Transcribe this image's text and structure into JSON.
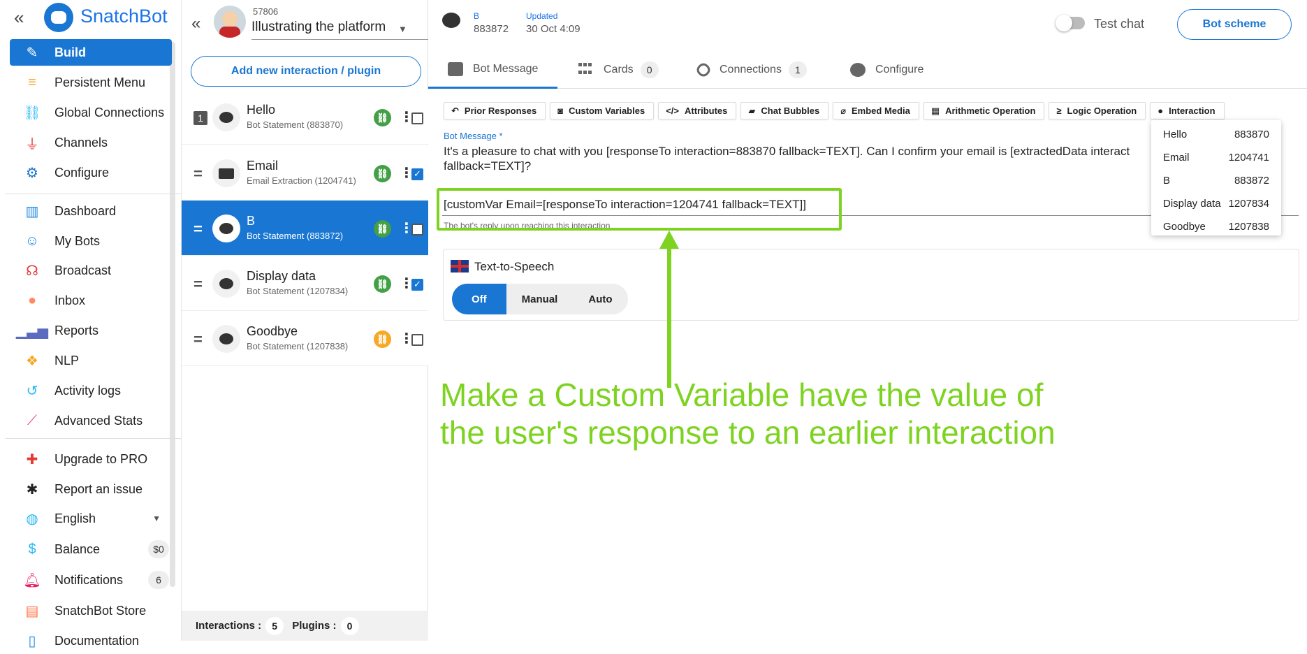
{
  "sidebar": {
    "brand": "SnatchBot",
    "items": [
      {
        "label": "Build",
        "icon": "edit-icon"
      },
      {
        "label": "Persistent Menu",
        "icon": "menu-icon"
      },
      {
        "label": "Global Connections",
        "icon": "link-icon"
      },
      {
        "label": "Channels",
        "icon": "plug-icon"
      },
      {
        "label": "Configure",
        "icon": "gear-icon"
      },
      {
        "label": "Dashboard",
        "icon": "dashboard-icon"
      },
      {
        "label": "My Bots",
        "icon": "robot-icon"
      },
      {
        "label": "Broadcast",
        "icon": "broadcast-icon"
      },
      {
        "label": "Inbox",
        "icon": "chat-icon"
      },
      {
        "label": "Reports",
        "icon": "bar-chart-icon"
      },
      {
        "label": "NLP",
        "icon": "nlp-icon"
      },
      {
        "label": "Activity logs",
        "icon": "history-icon"
      },
      {
        "label": "Advanced Stats",
        "icon": "line-chart-icon"
      },
      {
        "label": "Upgrade to PRO",
        "icon": "plus-icon"
      },
      {
        "label": "Report an issue",
        "icon": "bug-icon"
      },
      {
        "label": "English",
        "icon": "globe-icon"
      },
      {
        "label": "Balance",
        "icon": "dollar-icon",
        "badge": "$0"
      },
      {
        "label": "Notifications",
        "icon": "bell-icon",
        "badge": "6"
      },
      {
        "label": "SnatchBot Store",
        "icon": "store-icon"
      },
      {
        "label": "Documentation",
        "icon": "doc-icon"
      }
    ]
  },
  "panel": {
    "bot_id": "57806",
    "bot_name": "Illustrating the platform",
    "add_button": "Add new interaction / plugin",
    "interactions": [
      {
        "index": "1",
        "name": "Hello",
        "sub": "Bot Statement (883870)",
        "checked": false
      },
      {
        "name": "Email",
        "sub": "Email Extraction (1204741)",
        "checked": true
      },
      {
        "name": "B",
        "sub": "Bot Statement (883872)",
        "checked": false
      },
      {
        "name": "Display data",
        "sub": "Bot Statement (1207834)",
        "checked": true
      },
      {
        "name": "Goodbye",
        "sub": "Bot Statement (1207838)",
        "checked": false
      }
    ],
    "footer": {
      "interactions_label": "Interactions :",
      "interactions_count": "5",
      "plugins_label": "Plugins :",
      "plugins_count": "0"
    }
  },
  "main": {
    "top": {
      "name": "B",
      "id": "883872",
      "updated_label": "Updated",
      "updated_date": "30 Oct 4:09",
      "test_chat": "Test chat",
      "scheme": "Bot scheme"
    },
    "tabs": [
      {
        "label": "Bot Message"
      },
      {
        "label": "Cards",
        "count": "0"
      },
      {
        "label": "Connections",
        "count": "1"
      },
      {
        "label": "Configure"
      }
    ],
    "tools": [
      {
        "label": "Prior Responses",
        "icon": "↶"
      },
      {
        "label": "Custom Variables",
        "icon": "◙"
      },
      {
        "label": "Attributes",
        "icon": "</>"
      },
      {
        "label": "Chat Bubbles",
        "icon": "▰"
      },
      {
        "label": "Embed Media",
        "icon": "⌀"
      },
      {
        "label": "Arithmetic Operation",
        "icon": "▦"
      },
      {
        "label": "Logic Operation",
        "icon": "≥"
      },
      {
        "label": "Interaction",
        "icon": "●"
      }
    ],
    "bot_message_label": "Bot Message *",
    "bot_message_text": "It's a pleasure to chat with you [responseTo interaction=883870 fallback=TEXT]. Can I confirm your email is [extractedData interact",
    "bot_message_text_2": "fallback=TEXT]?",
    "bot_message_line": "[customVar Email=[responseTo interaction=1204741 fallback=TEXT]]",
    "hint": "The bot's reply upon reaching this interaction",
    "dropdown": [
      {
        "name": "Hello",
        "id": "883870"
      },
      {
        "name": "Email",
        "id": "1204741"
      },
      {
        "name": "B",
        "id": "883872"
      },
      {
        "name": "Display data",
        "id": "1207834"
      },
      {
        "name": "Goodbye",
        "id": "1207838"
      }
    ],
    "tts": {
      "title": "Text-to-Speech",
      "options": [
        "Off",
        "Manual",
        "Auto"
      ],
      "selected": "Off"
    },
    "caption": {
      "line1": "Make a Custom Variable have the value of",
      "line2": "the user's response to an earlier interaction"
    }
  },
  "colors": {
    "accent": "#1976d2",
    "annotation": "#7ed321"
  }
}
